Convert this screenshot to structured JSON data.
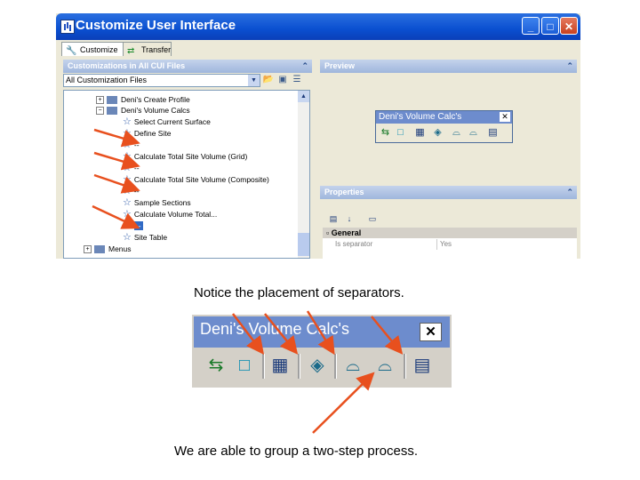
{
  "window": {
    "title": "Customize User Interface",
    "controls": {
      "minimize": "_",
      "maximize": "□",
      "close": "✕"
    }
  },
  "tabs": [
    {
      "label": "Customize",
      "icon": "wrench-icon"
    },
    {
      "label": "Transfer",
      "icon": "swap-arrows-icon"
    }
  ],
  "customizations_panel": {
    "header": "Customizations in All CUI Files",
    "filter_value": "All Customization Files",
    "tree": [
      {
        "label": "Deni's Create Profile",
        "level": 1,
        "expander": "+"
      },
      {
        "label": "Deni's Volume Calcs",
        "level": 1,
        "expander": "−"
      },
      {
        "label": "Select Current Surface",
        "level": 2
      },
      {
        "label": "Define Site",
        "level": 2
      },
      {
        "label": "--",
        "level": 2
      },
      {
        "label": "Calculate Total Site Volume (Grid)",
        "level": 2
      },
      {
        "label": "--",
        "level": 2
      },
      {
        "label": "Calculate Total Site Volume (Composite)",
        "level": 2
      },
      {
        "label": "--",
        "level": 2
      },
      {
        "label": "Sample Sections",
        "level": 2
      },
      {
        "label": "Calculate Volume Total...",
        "level": 2
      },
      {
        "label": "--",
        "level": 2,
        "selected": true
      },
      {
        "label": "Site Table",
        "level": 2
      },
      {
        "label": "Menus",
        "level": 0,
        "expander": "+"
      }
    ]
  },
  "preview_panel": {
    "header": "Preview",
    "toolbar_title": "Deni's Volume Calc's"
  },
  "properties_panel": {
    "header": "Properties",
    "category": "General",
    "rows": [
      {
        "name": "Is separator",
        "value": "Yes"
      }
    ]
  },
  "captions": {
    "top": "Notice the placement of separators.",
    "bottom": "We are able to group a two-step process."
  },
  "enlarged_toolbar": {
    "title": "Deni's Volume Calc's",
    "close": "✕"
  },
  "colors": {
    "titlebar": "#0a4fd0",
    "toolbar_title": "#6d8ccd",
    "arrow": "#e8501e"
  }
}
